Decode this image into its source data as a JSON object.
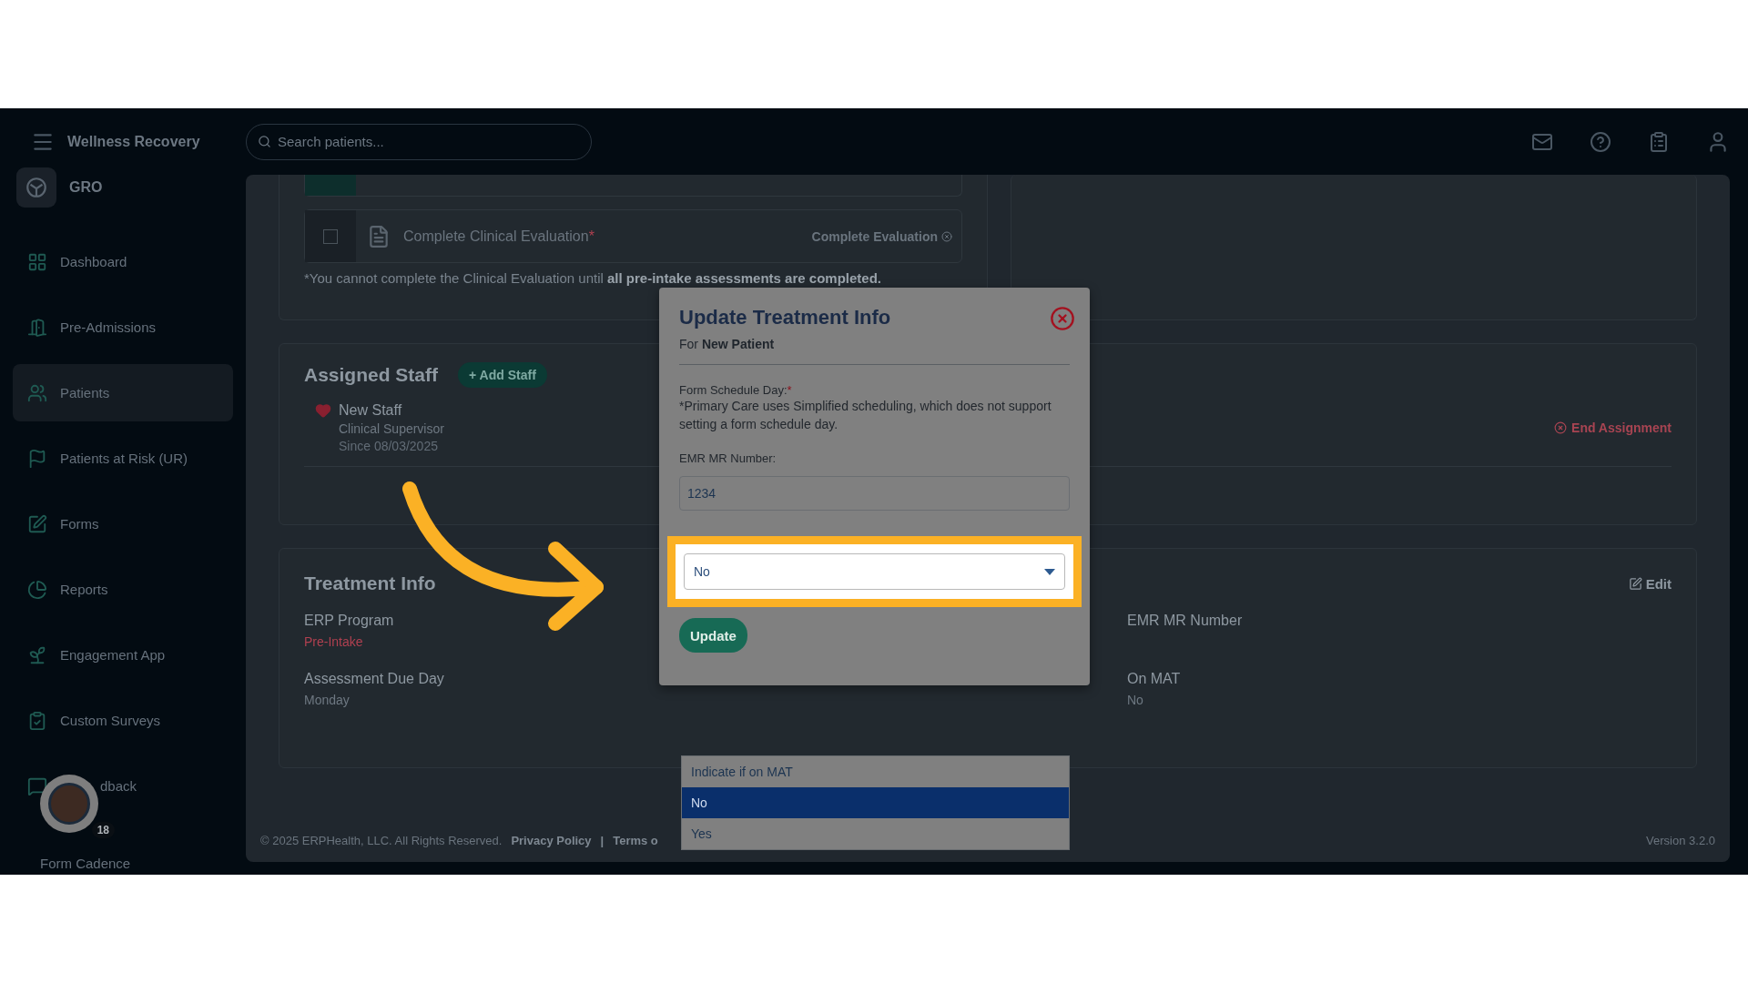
{
  "topbar": {
    "org": "Wellness Recovery",
    "search": {
      "placeholder": "Search patients..."
    }
  },
  "sidebar": {
    "brand": "GRO",
    "items": [
      {
        "label": "Dashboard",
        "selected": false
      },
      {
        "label": "Pre-Admissions",
        "selected": false
      },
      {
        "label": "Patients",
        "selected": true
      },
      {
        "label": "Patients at Risk (UR)",
        "selected": false
      },
      {
        "label": "Forms",
        "selected": false
      },
      {
        "label": "Reports",
        "selected": false
      },
      {
        "label": "Engagement App",
        "selected": false
      },
      {
        "label": "Custom Surveys",
        "selected": false
      },
      {
        "label": "dback",
        "selected": false
      }
    ],
    "helper": {
      "badge": "18",
      "caption": "Form Cadence"
    }
  },
  "tasks": [
    {
      "label": "Complete Clinical Evaluation",
      "required": "*",
      "action": "Complete Evaluation",
      "checked": false
    }
  ],
  "task_note": "*You cannot complete the Clinical Evaluation until **all pre-intake assessments are completed.**",
  "assigned_staff": {
    "title": "Assigned Staff",
    "add_button": "+ Add Staff",
    "staff": [
      {
        "name": "New Staff",
        "role": "Clinical Supervisor",
        "since": "Since 08/03/2025",
        "action": "End Assignment"
      }
    ]
  },
  "treatment_info": {
    "title": "Treatment Info",
    "edit": "Edit",
    "fields": [
      {
        "label": "ERP Program",
        "value": "Pre-Intake",
        "kind": "status"
      },
      {
        "label": "EMR MR Number",
        "kind": "plain"
      },
      {
        "label": "Assessment Due Day",
        "value": "Monday",
        "kind": "plain"
      },
      {
        "label": "On MAT",
        "value": "No",
        "kind": "plain"
      }
    ]
  },
  "footer": {
    "copyright": "© 2025 ERPHealth, LLC. All Rights Reserved.",
    "links": [
      "Privacy Policy",
      "Terms o"
    ],
    "separator": "|",
    "version": "Version 3.2.0"
  },
  "modal": {
    "title": "Update Treatment Info",
    "subtitle_prefix": "For",
    "subtitle_name": "New Patient",
    "schedule_label": "Form Schedule Day:",
    "required": "*",
    "schedule_note": "*Primary Care uses Simplified scheduling, which does not support setting a form schedule day.",
    "emr_label": "EMR MR Number:",
    "emr_value": "1234",
    "mat_value": "No",
    "update": "Update"
  },
  "dropdown": {
    "options": [
      {
        "label": "Indicate if on MAT",
        "selected": false
      },
      {
        "label": "No",
        "selected": true
      },
      {
        "label": "Yes",
        "selected": false
      }
    ]
  }
}
